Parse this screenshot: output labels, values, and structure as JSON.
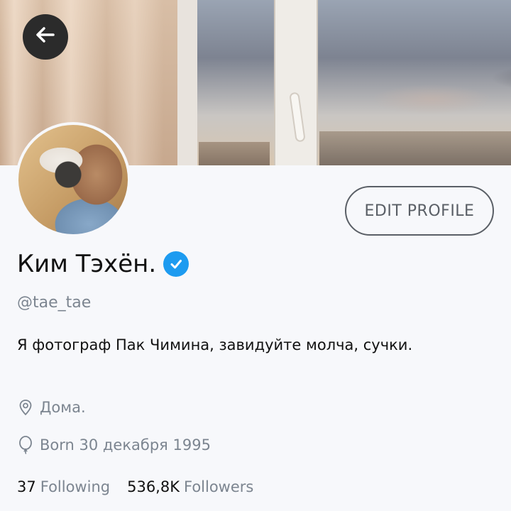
{
  "header": {
    "back_icon": "arrow-left-icon"
  },
  "profile": {
    "name": "Ким Тэхён.",
    "verified_icon": "verified-badge-icon",
    "handle": "@tae_tae",
    "bio": "Я фотограф Пак Чимина, завидуйте молча, сучки.",
    "edit_label": "EDIT PROFILE",
    "location": "Дома.",
    "location_icon": "location-pin-icon",
    "born": "Born 30 декабря 1995",
    "born_icon": "balloon-icon"
  },
  "stats": {
    "following_count": "37",
    "following_label": "Following",
    "followers_count": "536,8K",
    "followers_label": "Followers"
  },
  "colors": {
    "accent": "#1d9bf0",
    "muted_text": "#7c8590",
    "background": "#f7f8fb"
  }
}
